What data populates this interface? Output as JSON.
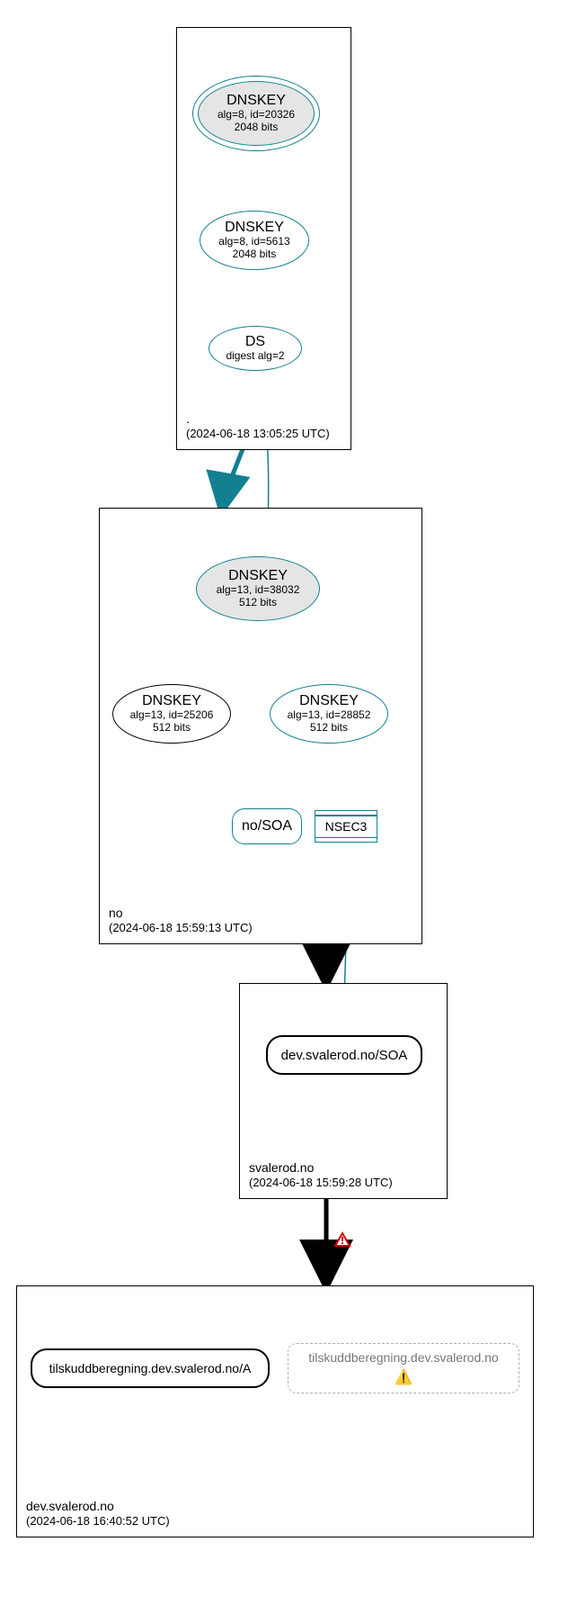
{
  "chart_data": {
    "type": "graph",
    "description": "DNSSEC authentication / delegation chain diagram",
    "zones": [
      {
        "id": "root",
        "name": ".",
        "timestamp": "(2024-06-18 13:05:25 UTC)"
      },
      {
        "id": "no",
        "name": "no",
        "timestamp": "(2024-06-18 15:59:13 UTC)"
      },
      {
        "id": "svalerod",
        "name": "svalerod.no",
        "timestamp": "(2024-06-18 15:59:28 UTC)"
      },
      {
        "id": "devsvalerod",
        "name": "dev.svalerod.no",
        "timestamp": "(2024-06-18 16:40:52 UTC)"
      }
    ],
    "nodes": [
      {
        "id": "root-ksk",
        "zone": "root",
        "type": "DNSKEY",
        "title": "DNSKEY",
        "sub1": "alg=8, id=20326",
        "sub2": "2048 bits",
        "trust_anchor": true
      },
      {
        "id": "root-zsk",
        "zone": "root",
        "type": "DNSKEY",
        "title": "DNSKEY",
        "sub1": "alg=8, id=5613",
        "sub2": "2048 bits"
      },
      {
        "id": "root-ds",
        "zone": "root",
        "type": "DS",
        "title": "DS",
        "sub1": "digest alg=2"
      },
      {
        "id": "no-ksk",
        "zone": "no",
        "type": "DNSKEY",
        "title": "DNSKEY",
        "sub1": "alg=13, id=38032",
        "sub2": "512 bits",
        "sep": true
      },
      {
        "id": "no-key1",
        "zone": "no",
        "type": "DNSKEY",
        "title": "DNSKEY",
        "sub1": "alg=13, id=25206",
        "sub2": "512 bits"
      },
      {
        "id": "no-key2",
        "zone": "no",
        "type": "DNSKEY",
        "title": "DNSKEY",
        "sub1": "alg=13, id=28852",
        "sub2": "512 bits"
      },
      {
        "id": "no-soa",
        "zone": "no",
        "type": "RRset",
        "label": "no/SOA"
      },
      {
        "id": "no-nsec3",
        "zone": "no",
        "type": "NSEC3",
        "label": "NSEC3"
      },
      {
        "id": "sv-soa",
        "zone": "svalerod",
        "type": "RRset",
        "label": "dev.svalerod.no/SOA"
      },
      {
        "id": "dev-a",
        "zone": "devsvalerod",
        "type": "RRset",
        "label": "tilskuddberegning.dev.svalerod.no/A"
      },
      {
        "id": "dev-name",
        "zone": "devsvalerod",
        "type": "name-warn",
        "label": "tilskuddberegning.dev.svalerod.no"
      }
    ],
    "edges": [
      {
        "from": "root-ksk",
        "to": "root-ksk",
        "kind": "self-sign",
        "style": "secure"
      },
      {
        "from": "root-ksk",
        "to": "root-zsk",
        "style": "secure"
      },
      {
        "from": "root-zsk",
        "to": "root-ds",
        "style": "secure"
      },
      {
        "from": "root-ds",
        "to": "no-ksk",
        "style": "secure"
      },
      {
        "from": "root",
        "to": "no",
        "kind": "delegation",
        "style": "secure-bold"
      },
      {
        "from": "no-ksk",
        "to": "no-ksk",
        "kind": "self-sign",
        "style": "secure"
      },
      {
        "from": "no-ksk",
        "to": "no-key1",
        "style": "secure"
      },
      {
        "from": "no-ksk",
        "to": "no-key2",
        "style": "secure"
      },
      {
        "from": "no-key2",
        "to": "no-soa",
        "style": "secure"
      },
      {
        "from": "no-key2",
        "to": "no-nsec3",
        "style": "secure"
      },
      {
        "from": "no-nsec3",
        "to": "sv-soa",
        "style": "secure"
      },
      {
        "from": "no",
        "to": "svalerod",
        "kind": "delegation",
        "style": "insecure-bold"
      },
      {
        "from": "svalerod",
        "to": "devsvalerod",
        "kind": "delegation",
        "style": "insecure-bold",
        "warning": true
      }
    ]
  },
  "icons": {
    "warning_small": "⚠",
    "warning_yellow": "⚠️"
  }
}
